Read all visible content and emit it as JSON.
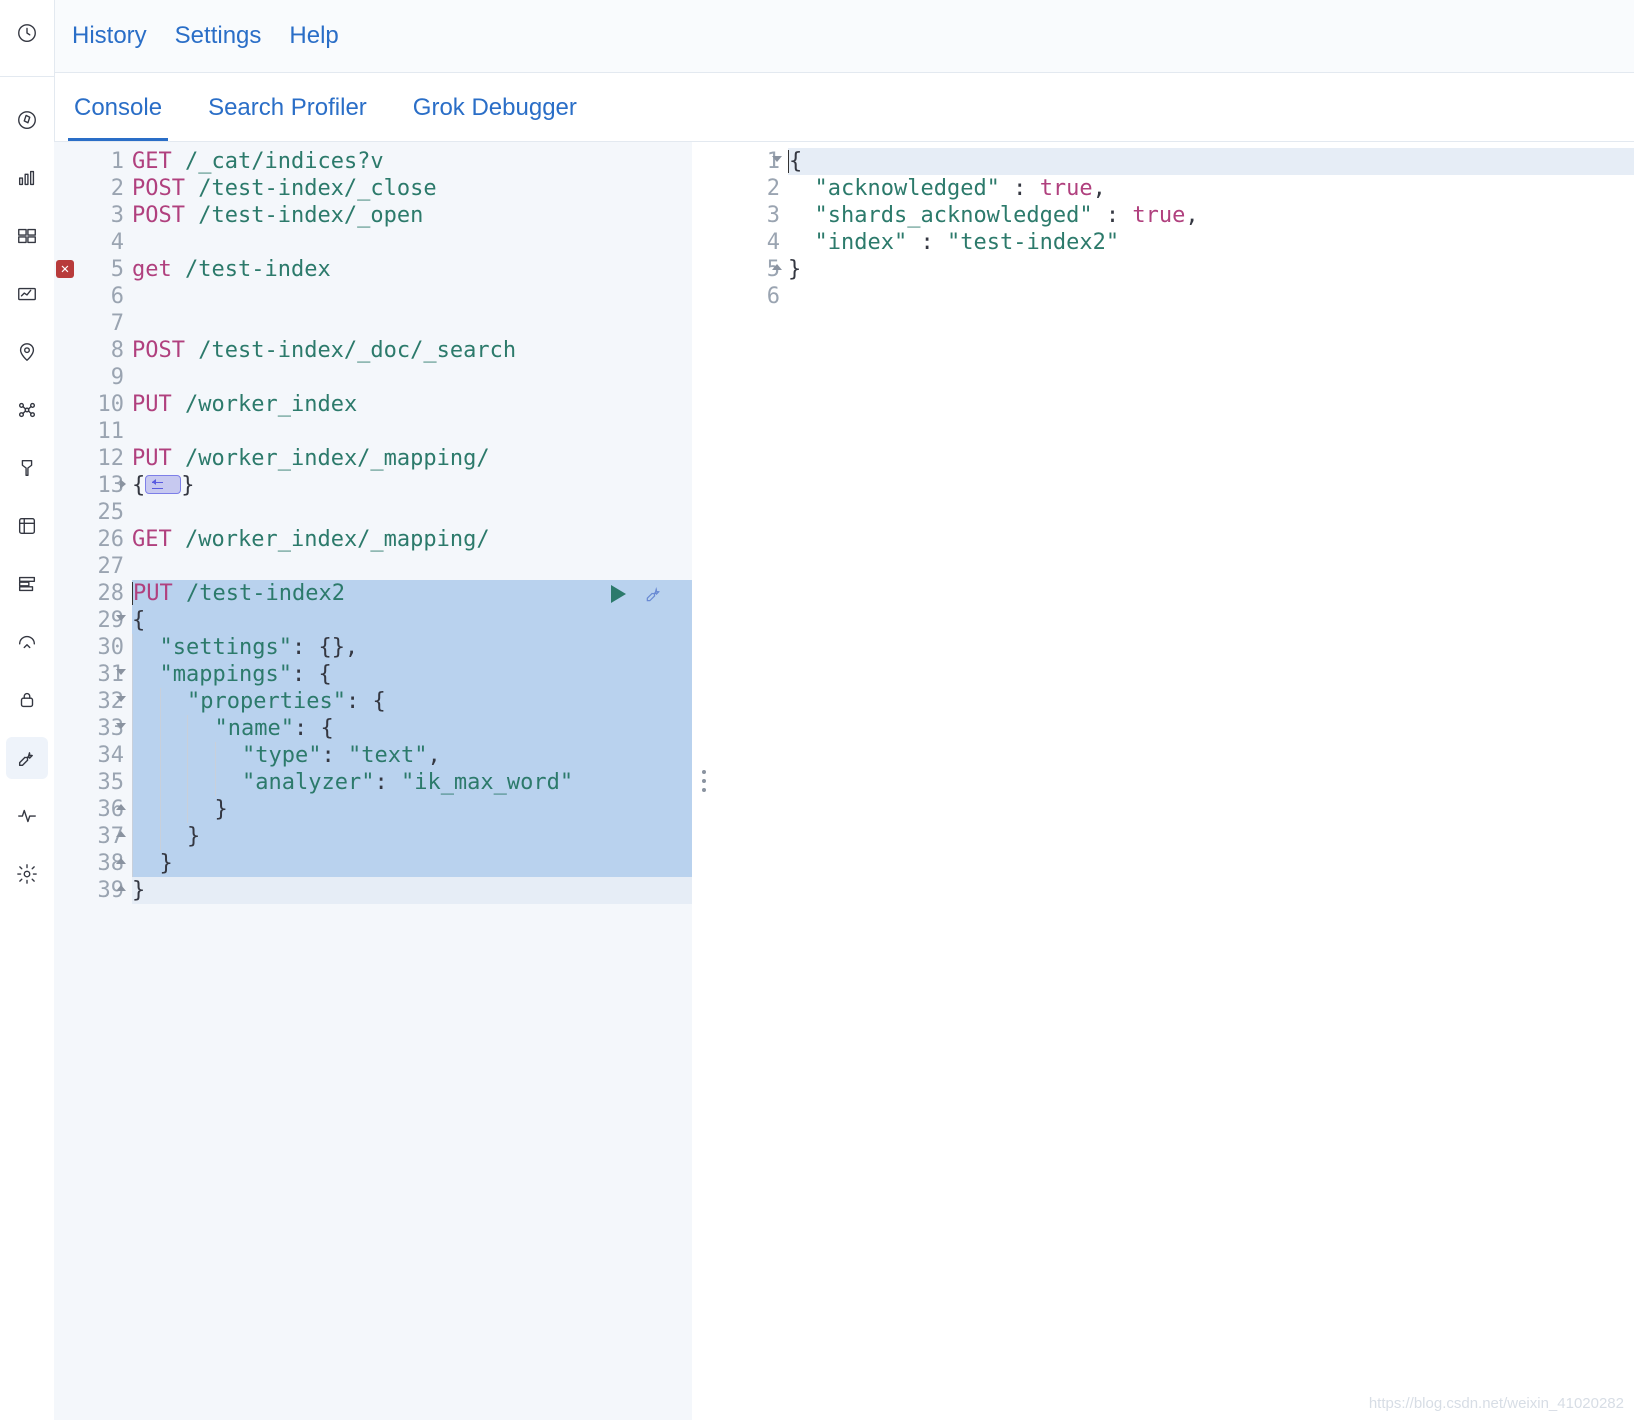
{
  "topbar": {
    "history": "History",
    "settings": "Settings",
    "help": "Help"
  },
  "tabs": {
    "console": "Console",
    "profiler": "Search Profiler",
    "grok": "Grok Debugger"
  },
  "request": {
    "lines": [
      {
        "n": 1,
        "method": "GET",
        "path": "/_cat/indices?v"
      },
      {
        "n": 2,
        "method": "POST",
        "path": "/test-index/_close"
      },
      {
        "n": 3,
        "method": "POST",
        "path": "/test-index/_open"
      },
      {
        "n": 4,
        "blank": true
      },
      {
        "n": 5,
        "method": "get",
        "path": "/test-index",
        "error": true
      },
      {
        "n": 6,
        "blank": true
      },
      {
        "n": 7,
        "blank": true
      },
      {
        "n": 8,
        "method": "POST",
        "path": "/test-index/_doc/_search"
      },
      {
        "n": 9,
        "blank": true
      },
      {
        "n": 10,
        "method": "PUT",
        "path": "/worker_index"
      },
      {
        "n": 11,
        "blank": true
      },
      {
        "n": 12,
        "method": "PUT",
        "path": "/worker_index/_mapping/"
      },
      {
        "n": 13,
        "foldRight": true,
        "raw": "{",
        "foldedPill": true,
        "rawTrail": "}"
      },
      {
        "n": 25,
        "blank": true
      },
      {
        "n": 26,
        "method": "GET",
        "path": "/worker_index/_mapping/"
      },
      {
        "n": 27,
        "blank": true
      },
      {
        "n": 28,
        "method": "PUT",
        "path": "/test-index2",
        "cursor": true,
        "sel": true,
        "actions": true
      },
      {
        "n": 29,
        "foldDown": true,
        "sel": true,
        "raw": "{"
      },
      {
        "n": 30,
        "sel": true,
        "indent": 1,
        "keyq": "\"settings\"",
        "after": ": {},"
      },
      {
        "n": 31,
        "foldDown": true,
        "sel": true,
        "indent": 1,
        "keyq": "\"mappings\"",
        "after": ": {"
      },
      {
        "n": 32,
        "foldDown": true,
        "sel": true,
        "indent": 2,
        "keyq": "\"properties\"",
        "after": ": {"
      },
      {
        "n": 33,
        "foldDown": true,
        "sel": true,
        "indent": 3,
        "keyq": "\"name\"",
        "after": ": {"
      },
      {
        "n": 34,
        "sel": true,
        "indent": 4,
        "keyq": "\"type\"",
        "after": ": ",
        "strv": "\"text\"",
        "trail": ","
      },
      {
        "n": 35,
        "sel": true,
        "indent": 4,
        "keyq": "\"analyzer\"",
        "after": ": ",
        "strv": "\"ik_max_word\""
      },
      {
        "n": 36,
        "foldUp": true,
        "sel": true,
        "indent": 3,
        "raw": "}"
      },
      {
        "n": 37,
        "foldUp": true,
        "sel": true,
        "indent": 2,
        "raw": "}"
      },
      {
        "n": 38,
        "foldUp": true,
        "sel": true,
        "indent": 1,
        "raw": "}"
      },
      {
        "n": 39,
        "foldUp": true,
        "raw": "}",
        "cursorLine": true
      }
    ]
  },
  "response": {
    "lines": [
      {
        "n": 1,
        "foldDown": true,
        "cursorLine": true,
        "raw": "{",
        "caret": true
      },
      {
        "n": 2,
        "indent": 1,
        "keyq": "\"acknowledged\"",
        "after": " : ",
        "boolv": "true",
        "trail": ","
      },
      {
        "n": 3,
        "indent": 1,
        "keyq": "\"shards_acknowledged\"",
        "after": " : ",
        "boolv": "true",
        "trail": ","
      },
      {
        "n": 4,
        "indent": 1,
        "keyq": "\"index\"",
        "after": " : ",
        "strv": "\"test-index2\""
      },
      {
        "n": 5,
        "foldUp": true,
        "raw": "}"
      },
      {
        "n": 6,
        "blank": true
      }
    ]
  },
  "sidebar": {
    "items": [
      "clock-icon",
      "compass-icon",
      "dashboard-icon",
      "panels-icon",
      "visualize-icon",
      "map-pin-icon",
      "graph-icon",
      "ml-icon",
      "metrics-icon",
      "apm-icon",
      "uptime-icon",
      "siem-icon",
      "devtools-icon",
      "monitoring-icon",
      "management-icon"
    ],
    "activeIndex": 12
  },
  "watermark": "https://blog.csdn.net/weixin_41020282"
}
